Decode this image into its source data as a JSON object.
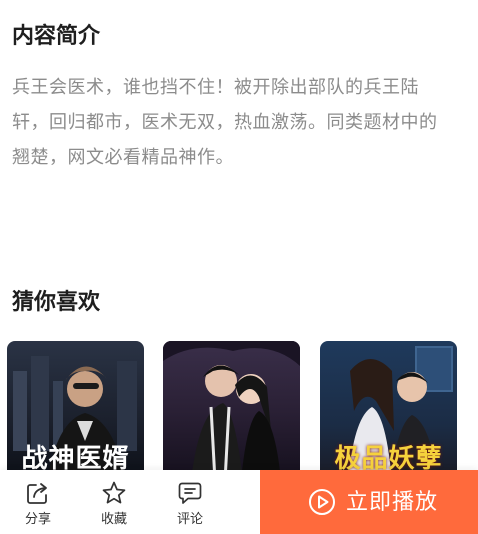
{
  "intro": {
    "title": "内容简介",
    "text": "兵王会医术，谁也挡不住！被开除出部队的兵王陆轩，回归都市，医术无双，热血激荡。同类题材中的翘楚，网文必看精品神作。"
  },
  "recommend": {
    "title": "猜你喜欢",
    "items": [
      {
        "title": "战神医婿",
        "title_color": "#ffffff"
      },
      {
        "title": "",
        "title_color": "#ffffff"
      },
      {
        "title": "极品妖孽",
        "title_color": "#f6d23c"
      }
    ]
  },
  "bottom_bar": {
    "share_label": "分享",
    "share_icon": "share-icon",
    "favorite_label": "收藏",
    "favorite_icon": "star-icon",
    "comment_label": "评论",
    "comment_icon": "comment-icon",
    "play_label": "立即播放",
    "play_icon": "play-circle-icon",
    "play_color": "#ff6a3c"
  }
}
